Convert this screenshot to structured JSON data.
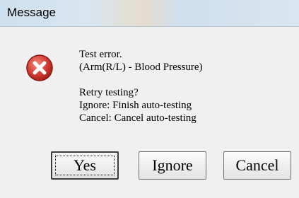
{
  "window": {
    "title": "Message"
  },
  "icon": {
    "name": "error-icon",
    "color": "#d23a32"
  },
  "message": {
    "lines": [
      "Test error.",
      "(Arm(R/L) - Blood Pressure)",
      "Retry testing?",
      "Ignore: Finish auto-testing",
      "Cancel: Cancel auto-testing"
    ]
  },
  "buttons": {
    "yes": "Yes",
    "ignore": "Ignore",
    "cancel": "Cancel"
  }
}
